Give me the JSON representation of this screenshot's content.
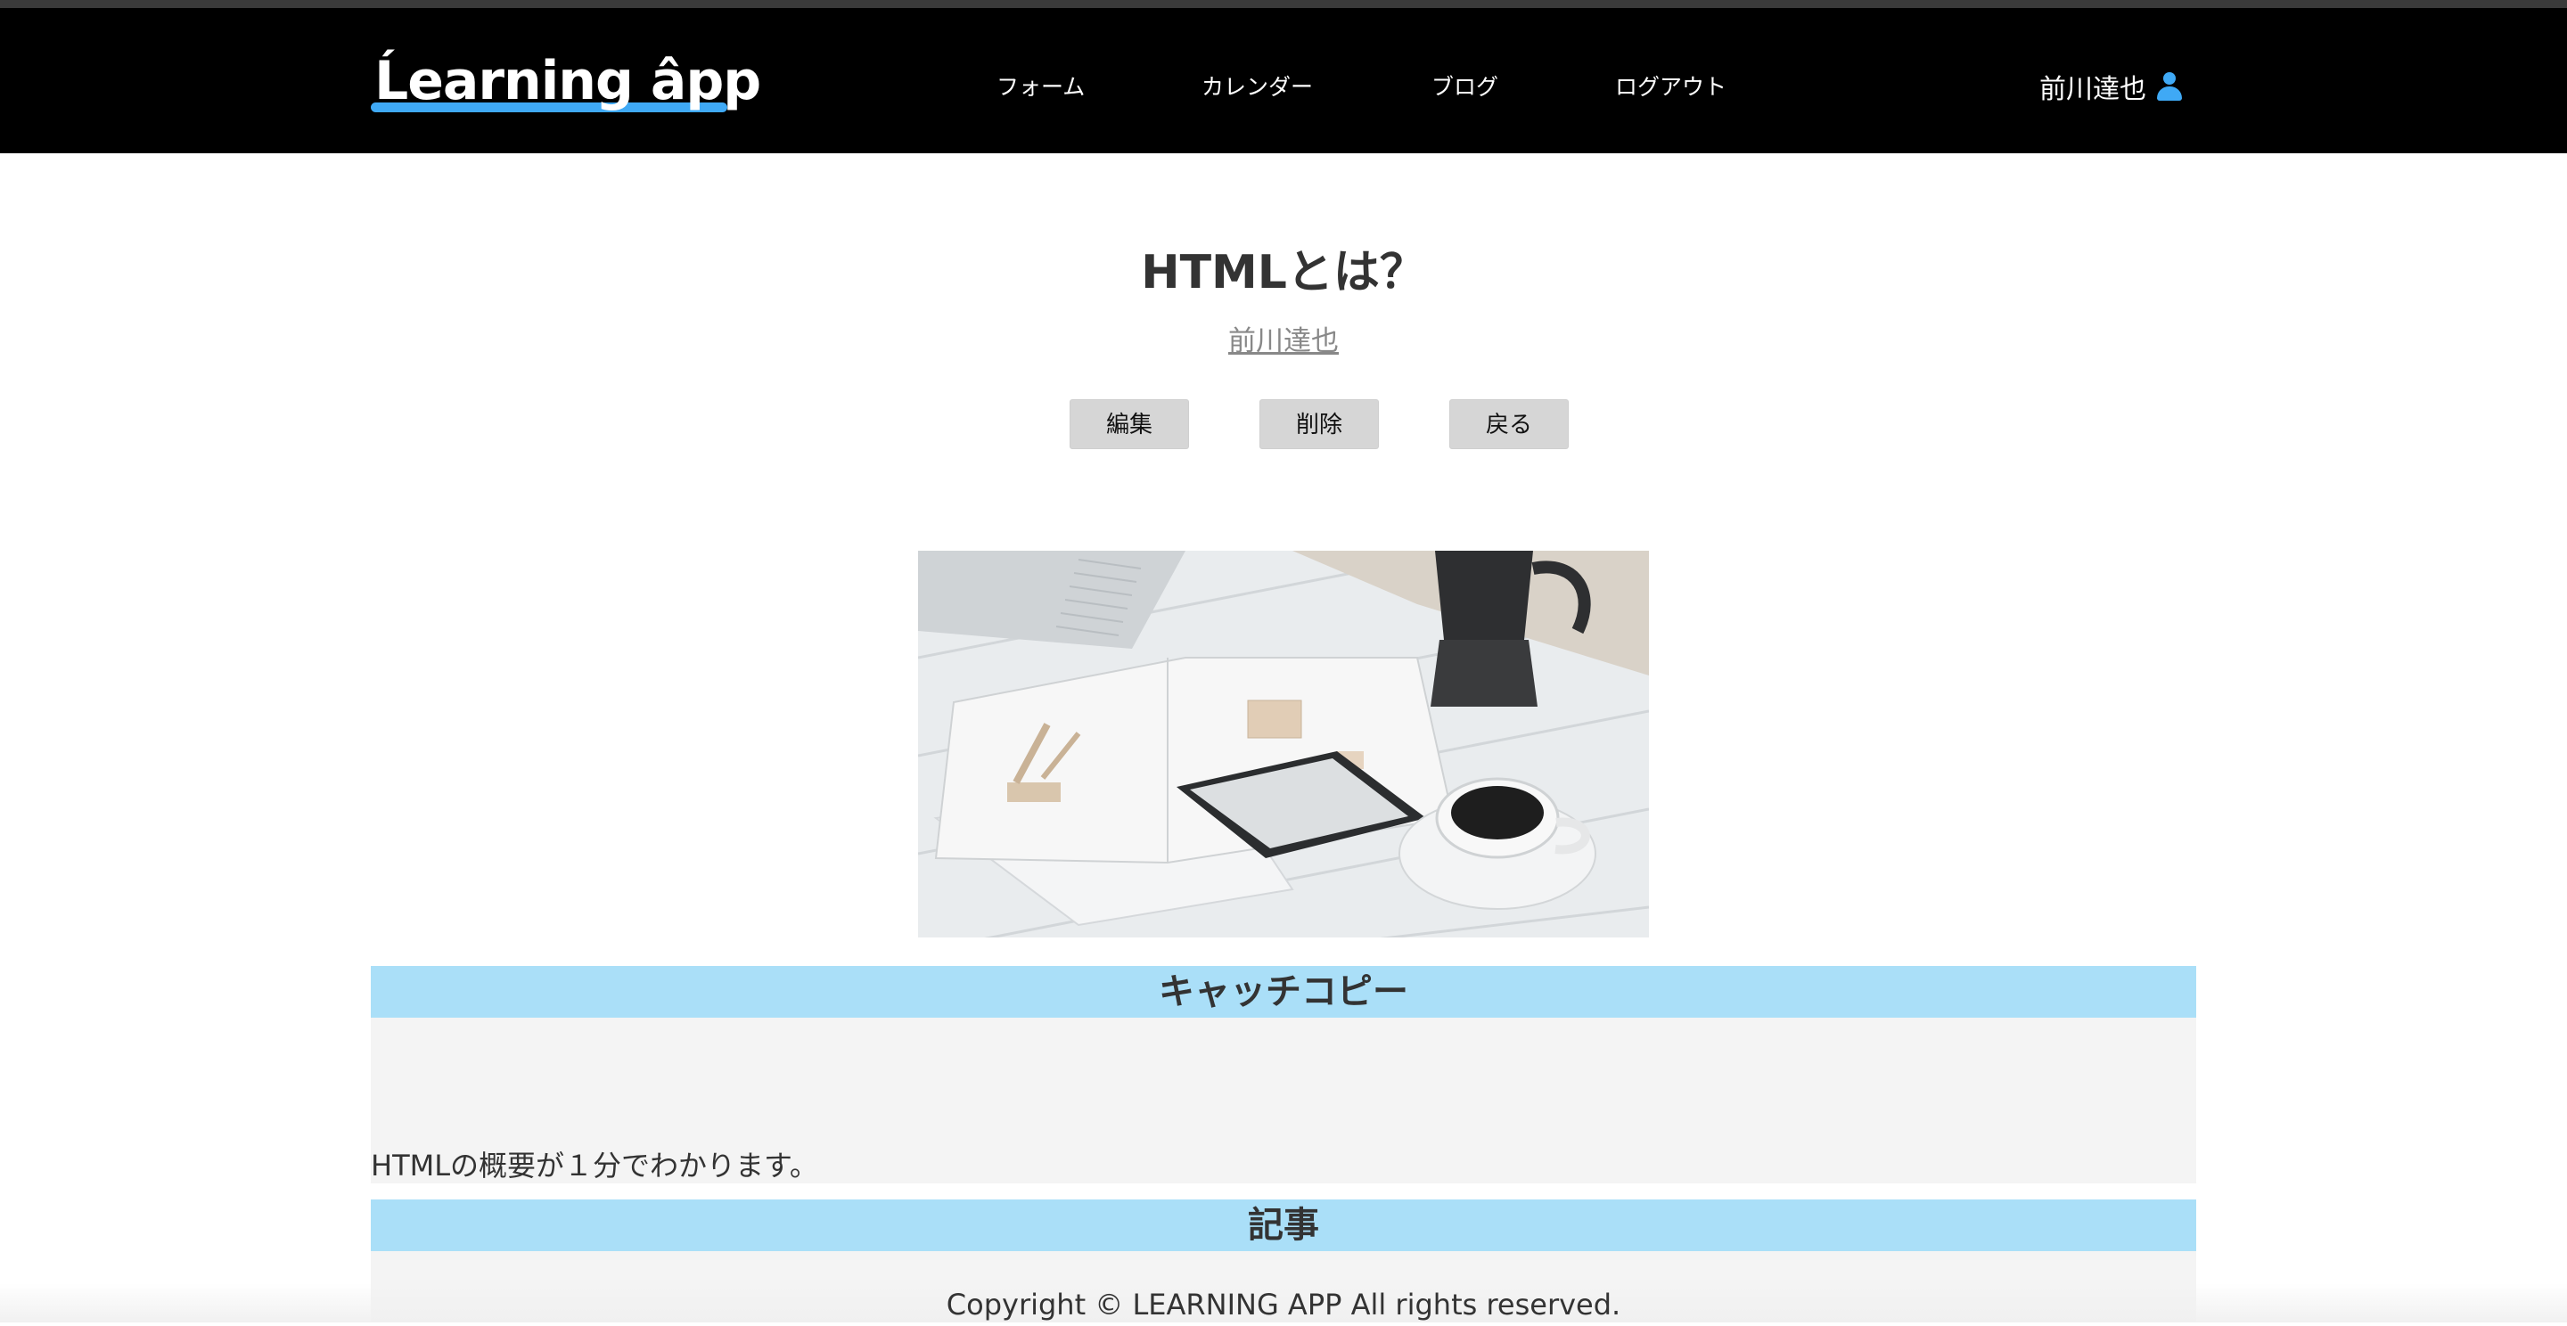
{
  "header": {
    "logo_text": "Ĺearning âpp",
    "nav": [
      "フォーム",
      "カレンダー",
      "ブログ",
      "ログアウト"
    ],
    "user_name": "前川達也"
  },
  "post": {
    "title": "HTMLとは？",
    "author": "前川達也",
    "buttons": {
      "edit": "編集",
      "delete": "削除",
      "back": "戻る"
    }
  },
  "sections": {
    "catch_copy_heading": "キャッチコピー",
    "catch_copy_text": "HTMLの概要が１分でわかります。",
    "article_heading": "記事"
  },
  "footer": {
    "copyright": "Copyright © LEARNING APP All rights reserved."
  },
  "colors": {
    "accent": "#3fa9f5",
    "section_header": "#aadff8",
    "header_bg": "#000000"
  }
}
